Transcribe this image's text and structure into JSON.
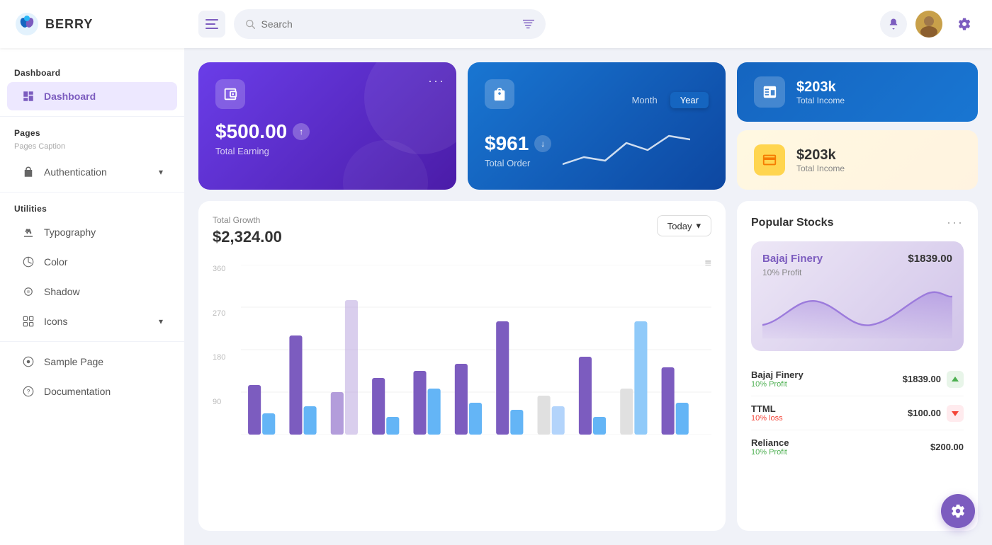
{
  "app": {
    "logo_text": "BERRY",
    "search_placeholder": "Search"
  },
  "sidebar": {
    "dashboard_section": "Dashboard",
    "dashboard_item": "Dashboard",
    "pages_section": "Pages",
    "pages_caption": "Pages Caption",
    "authentication_item": "Authentication",
    "utilities_section": "Utilities",
    "typography_item": "Typography",
    "color_item": "Color",
    "shadow_item": "Shadow",
    "icons_item": "Icons",
    "sample_page_item": "Sample Page",
    "documentation_item": "Documentation"
  },
  "earning_card": {
    "amount": "$500.00",
    "label": "Total Earning",
    "more": "···"
  },
  "order_card": {
    "amount": "$961",
    "label": "Total Order",
    "toggle_month": "Month",
    "toggle_year": "Year"
  },
  "income_card_1": {
    "amount": "$203k",
    "label": "Total Income"
  },
  "income_card_2": {
    "amount": "$203k",
    "label": "Total Income"
  },
  "growth_chart": {
    "title": "Total Growth",
    "amount": "$2,324.00",
    "period_btn": "Today",
    "y_labels": [
      "360",
      "270",
      "180",
      "90",
      ""
    ],
    "menu_icon": "≡"
  },
  "stocks": {
    "title": "Popular Stocks",
    "more": "···",
    "featured": {
      "name": "Bajaj Finery",
      "price": "$1839.00",
      "profit": "10% Profit"
    },
    "list": [
      {
        "name": "Bajaj Finery",
        "price": "$1839.00",
        "profit": "10% Profit",
        "trend": "up"
      },
      {
        "name": "TTML",
        "price": "$100.00",
        "profit": "10% loss",
        "trend": "down"
      },
      {
        "name": "Reliance",
        "price": "$200.00",
        "profit": "10% Profit",
        "trend": "up"
      }
    ]
  }
}
